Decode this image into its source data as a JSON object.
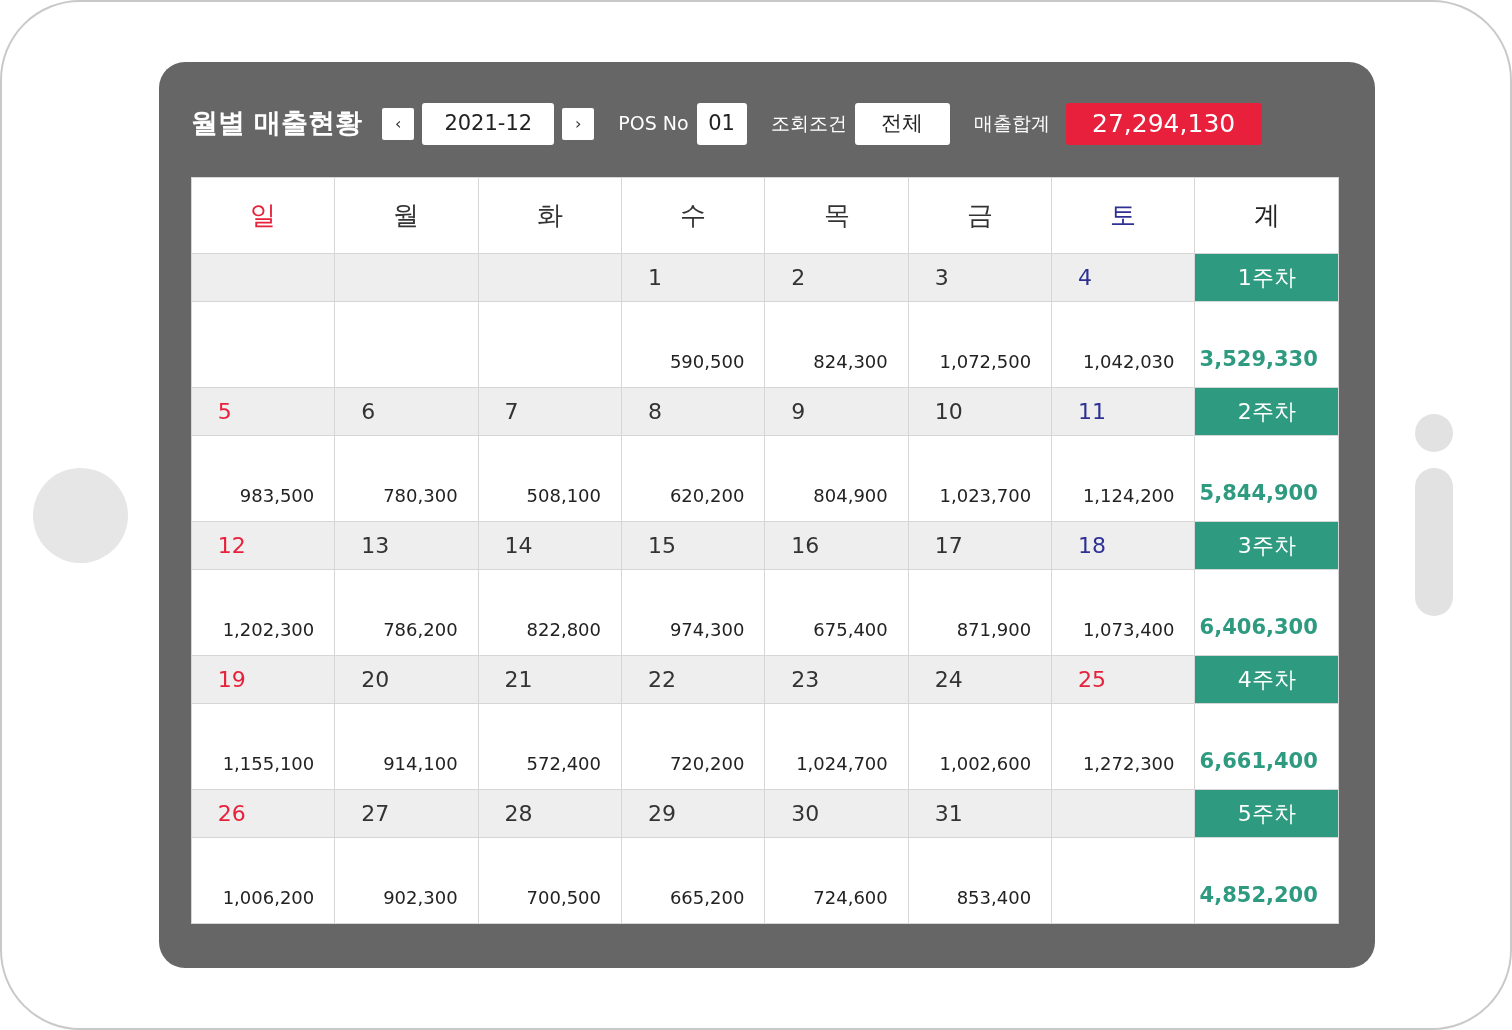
{
  "title": "월별 매출현황",
  "month": {
    "prev": "‹",
    "value": "2021-12",
    "next": "›"
  },
  "pos": {
    "label": "POS No",
    "value": "01"
  },
  "filter": {
    "label": "조회조건",
    "value": "전체"
  },
  "total": {
    "label": "매출합계",
    "value": "27,294,130"
  },
  "weekdays": [
    {
      "label": "일",
      "color": "#e8213b"
    },
    {
      "label": "월",
      "color": "#333333"
    },
    {
      "label": "화",
      "color": "#333333"
    },
    {
      "label": "수",
      "color": "#333333"
    },
    {
      "label": "목",
      "color": "#333333"
    },
    {
      "label": "금",
      "color": "#333333"
    },
    {
      "label": "토",
      "color": "#2e3192"
    }
  ],
  "total_column": "계",
  "weeks": [
    {
      "label": "1주차",
      "total": "3,529,330",
      "days": [
        {
          "kind": "blank"
        },
        {
          "kind": "blank"
        },
        {
          "kind": "blank"
        },
        {
          "kind": "day",
          "date": "1",
          "amount": "590,500",
          "color": "#333333"
        },
        {
          "kind": "day",
          "date": "2",
          "amount": "824,300",
          "color": "#333333"
        },
        {
          "kind": "day",
          "date": "3",
          "amount": "1,072,500",
          "color": "#333333"
        },
        {
          "kind": "day",
          "date": "4",
          "amount": "1,042,030",
          "color": "#2e3192"
        }
      ]
    },
    {
      "label": "2주차",
      "total": "5,844,900",
      "days": [
        {
          "kind": "day",
          "date": "5",
          "amount": "983,500",
          "color": "#e8213b"
        },
        {
          "kind": "day",
          "date": "6",
          "amount": "780,300",
          "color": "#333333"
        },
        {
          "kind": "day",
          "date": "7",
          "amount": "508,100",
          "color": "#333333"
        },
        {
          "kind": "day",
          "date": "8",
          "amount": "620,200",
          "color": "#333333"
        },
        {
          "kind": "day",
          "date": "9",
          "amount": "804,900",
          "color": "#333333"
        },
        {
          "kind": "day",
          "date": "10",
          "amount": "1,023,700",
          "color": "#333333"
        },
        {
          "kind": "day",
          "date": "11",
          "amount": "1,124,200",
          "color": "#2e3192"
        }
      ]
    },
    {
      "label": "3주차",
      "total": "6,406,300",
      "days": [
        {
          "kind": "day",
          "date": "12",
          "amount": "1,202,300",
          "color": "#e8213b"
        },
        {
          "kind": "day",
          "date": "13",
          "amount": "786,200",
          "color": "#333333"
        },
        {
          "kind": "day",
          "date": "14",
          "amount": "822,800",
          "color": "#333333"
        },
        {
          "kind": "day",
          "date": "15",
          "amount": "974,300",
          "color": "#333333"
        },
        {
          "kind": "day",
          "date": "16",
          "amount": "675,400",
          "color": "#333333"
        },
        {
          "kind": "day",
          "date": "17",
          "amount": "871,900",
          "color": "#333333"
        },
        {
          "kind": "day",
          "date": "18",
          "amount": "1,073,400",
          "color": "#2e3192"
        }
      ]
    },
    {
      "label": "4주차",
      "total": "6,661,400",
      "days": [
        {
          "kind": "day",
          "date": "19",
          "amount": "1,155,100",
          "color": "#e8213b"
        },
        {
          "kind": "day",
          "date": "20",
          "amount": "914,100",
          "color": "#333333"
        },
        {
          "kind": "day",
          "date": "21",
          "amount": "572,400",
          "color": "#333333"
        },
        {
          "kind": "day",
          "date": "22",
          "amount": "720,200",
          "color": "#333333"
        },
        {
          "kind": "day",
          "date": "23",
          "amount": "1,024,700",
          "color": "#333333"
        },
        {
          "kind": "day",
          "date": "24",
          "amount": "1,002,600",
          "color": "#333333"
        },
        {
          "kind": "day",
          "date": "25",
          "amount": "1,272,300",
          "color": "#e8213b"
        }
      ]
    },
    {
      "label": "5주차",
      "total": "4,852,200",
      "days": [
        {
          "kind": "day",
          "date": "26",
          "amount": "1,006,200",
          "color": "#e8213b"
        },
        {
          "kind": "day",
          "date": "27",
          "amount": "902,300",
          "color": "#333333"
        },
        {
          "kind": "day",
          "date": "28",
          "amount": "700,500",
          "color": "#333333"
        },
        {
          "kind": "day",
          "date": "29",
          "amount": "665,200",
          "color": "#333333"
        },
        {
          "kind": "day",
          "date": "30",
          "amount": "724,600",
          "color": "#333333"
        },
        {
          "kind": "day",
          "date": "31",
          "amount": "853,400",
          "color": "#333333"
        },
        {
          "kind": "blank"
        }
      ]
    }
  ]
}
